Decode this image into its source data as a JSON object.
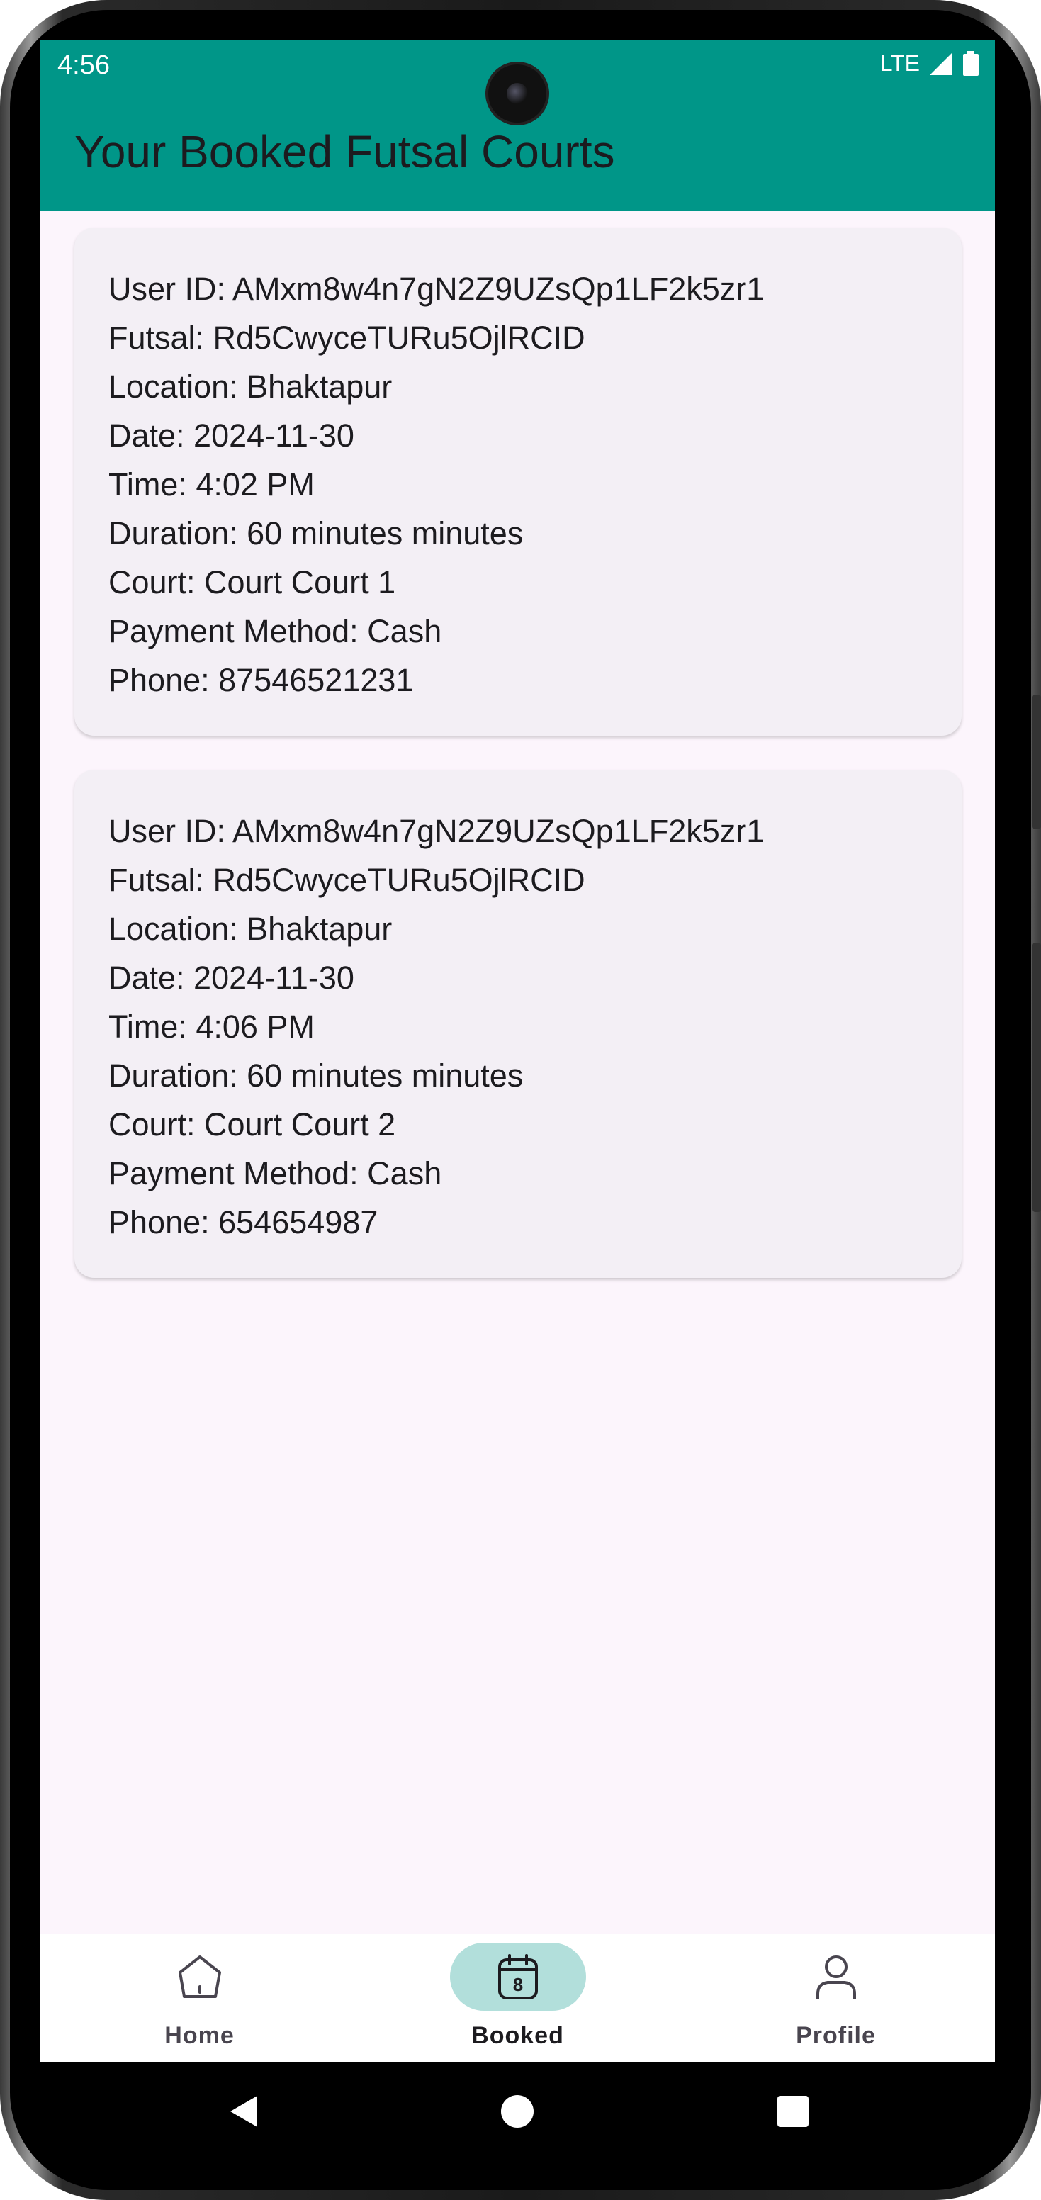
{
  "status_bar": {
    "time": "4:56",
    "network": "LTE"
  },
  "app_bar": {
    "title": "Your Booked Futsal Courts",
    "color": "#009688"
  },
  "bookings": [
    {
      "user_id": "User ID: AMxm8w4n7gN2Z9UZsQp1LF2k5zr1",
      "futsal": "Futsal: Rd5CwyceTURu5OjlRCID",
      "location": "Location: Bhaktapur",
      "date": "Date: 2024-11-30",
      "time": "Time: 4:02 PM",
      "duration": "Duration: 60 minutes minutes",
      "court": "Court: Court Court 1",
      "payment": "Payment Method: Cash",
      "phone": "Phone: 87546521231"
    },
    {
      "user_id": "User ID: AMxm8w4n7gN2Z9UZsQp1LF2k5zr1",
      "futsal": "Futsal: Rd5CwyceTURu5OjlRCID",
      "location": "Location: Bhaktapur",
      "date": "Date: 2024-11-30",
      "time": "Time: 4:06 PM",
      "duration": "Duration: 60 minutes minutes",
      "court": "Court: Court Court 2",
      "payment": "Payment Method: Cash",
      "phone": "Phone: 654654987"
    }
  ],
  "bottom_nav": {
    "items": [
      {
        "label": "Home",
        "icon": "home-icon",
        "active": false
      },
      {
        "label": "Booked",
        "icon": "calendar-icon",
        "active": true,
        "badge": "8"
      },
      {
        "label": "Profile",
        "icon": "person-icon",
        "active": false
      }
    ],
    "active_color": "#b2dfdb"
  },
  "system_nav": {
    "icons": [
      "back-icon",
      "home-circle-icon",
      "recents-icon"
    ]
  }
}
